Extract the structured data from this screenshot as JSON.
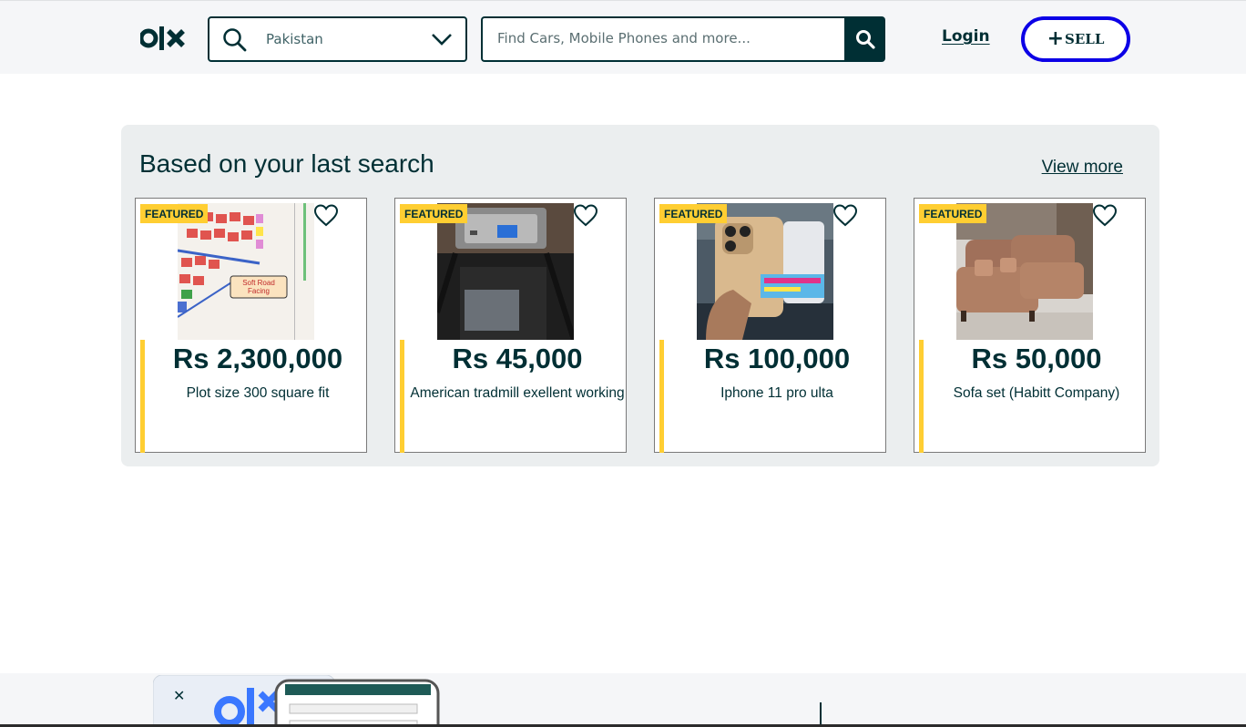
{
  "header": {
    "location": {
      "value": "Pakistan"
    },
    "search": {
      "placeholder": "Find Cars, Mobile Phones and more..."
    },
    "login_label": "Login",
    "sell_label": "SELL",
    "sell_plus": "+"
  },
  "recommendations": {
    "title": "Based on your last search",
    "view_more_label": "View more",
    "items": [
      {
        "badge": "FEATURED",
        "price": "Rs 2,300,000",
        "title": "Plot size 300 square fit"
      },
      {
        "badge": "FEATURED",
        "price": "Rs 45,000",
        "title": "American tradmill exellent working"
      },
      {
        "badge": "FEATURED",
        "price": "Rs 100,000",
        "title": "Iphone 11 pro ulta"
      },
      {
        "badge": "FEATURED",
        "price": "Rs 50,000",
        "title": "Sofa set (Habitt Company)"
      }
    ]
  },
  "colors": {
    "brand_dark": "#002f34",
    "featured_yellow": "#ffce32",
    "sell_border": "#0c00e6",
    "panel_bg": "#ebeeef"
  },
  "icons": [
    "olx-logo",
    "search-icon",
    "chevron-down-icon",
    "heart-icon",
    "phone-mockup-image"
  ]
}
